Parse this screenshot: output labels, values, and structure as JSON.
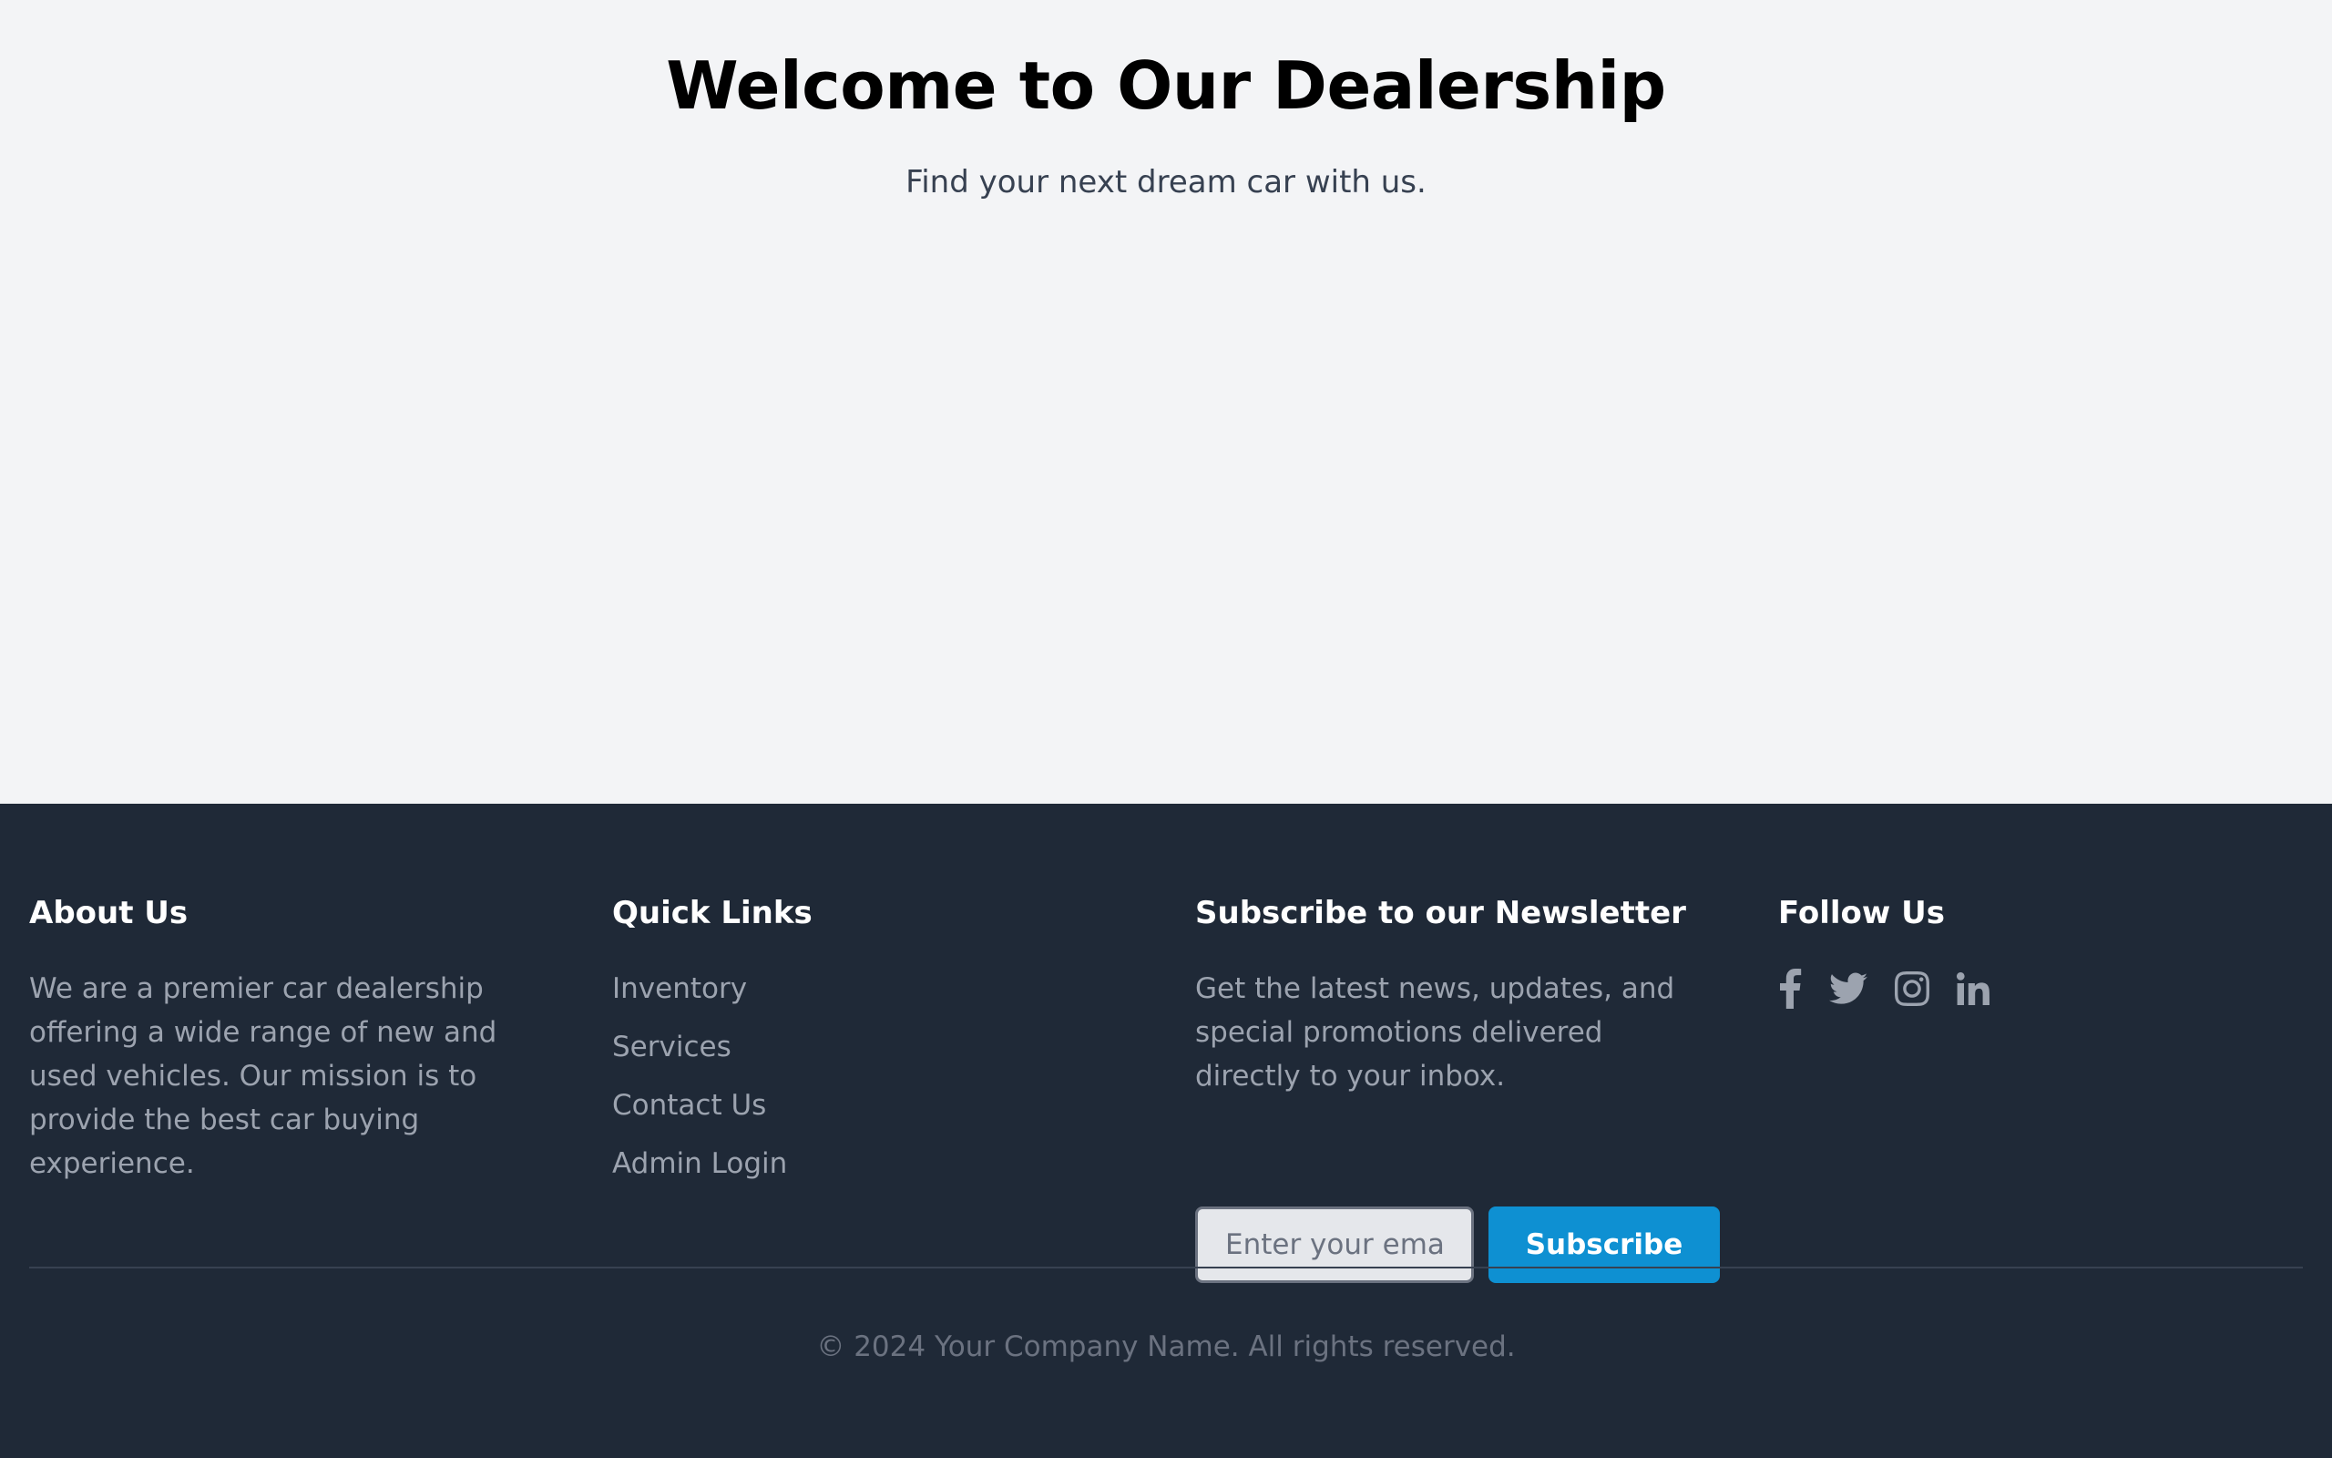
{
  "hero": {
    "title": "Welcome to Our Dealership",
    "subtitle": "Find your next dream car with us."
  },
  "footer": {
    "about": {
      "title": "About Us",
      "text": "We are a premier car dealership offering a wide range of new and used vehicles. Our mission is to provide the best car buying experience."
    },
    "quick_links": {
      "title": "Quick Links",
      "items": [
        "Inventory",
        "Services",
        "Contact Us",
        "Admin Login"
      ]
    },
    "newsletter": {
      "title": "Subscribe to our Newsletter",
      "text": "Get the latest news, updates, and special promotions delivered directly to your inbox.",
      "input_placeholder": "Enter your email",
      "button_label": "Subscribe"
    },
    "follow": {
      "title": "Follow Us",
      "icons": [
        "facebook-icon",
        "twitter-icon",
        "instagram-icon",
        "linkedin-icon"
      ]
    },
    "copyright": "© 2024 Your Company Name. All rights reserved."
  },
  "colors": {
    "page_bg": "#f3f4f6",
    "footer_bg": "#1f2937",
    "accent": "#0e90d2",
    "muted_text": "#9ca3af"
  }
}
